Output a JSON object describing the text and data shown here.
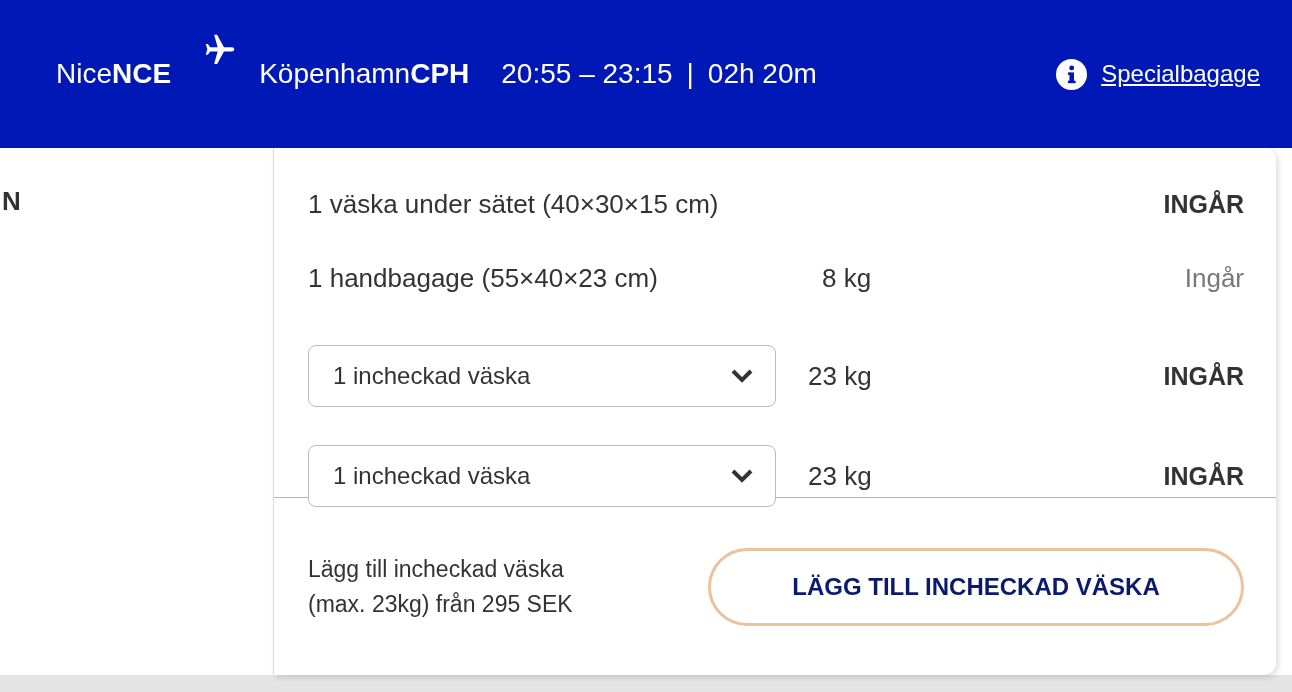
{
  "header": {
    "origin": {
      "city": "Nice",
      "code": "NCE"
    },
    "destination": {
      "city": "Köpenhamn",
      "code": "CPH"
    },
    "times": "20:55 – 23:15",
    "separator": "|",
    "duration": "02h 20m",
    "link": "Specialbagage"
  },
  "left_panel": {
    "heading": "N"
  },
  "baggage": [
    {
      "kind": "text",
      "label": "1 väska under sätet (40×30×15 cm)",
      "status": "INGÅR",
      "emphasis": true
    },
    {
      "kind": "text",
      "label": "1 handbagage (55×40×23 cm)",
      "weight": "8 kg",
      "status": "Ingår",
      "emphasis": false
    },
    {
      "kind": "select",
      "label": "1 incheckad väska",
      "weight": "23 kg",
      "status": "INGÅR",
      "emphasis": true
    },
    {
      "kind": "select",
      "label": "1 incheckad väska",
      "weight": "23 kg",
      "status": "INGÅR",
      "emphasis": true
    }
  ],
  "footer": {
    "note": "Lägg till incheckad väska (max. 23kg) från 295 SEK",
    "button": "LÄGG TILL INCHECKAD VÄSKA"
  }
}
